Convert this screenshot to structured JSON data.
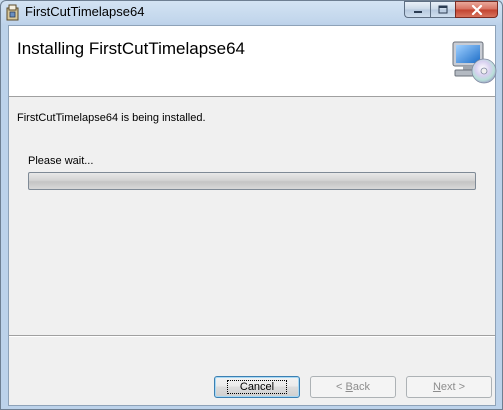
{
  "window": {
    "title": "FirstCutTimelapse64",
    "controls": {
      "minimize_icon": "minimize-icon",
      "maximize_icon": "maximize-icon",
      "close_icon": "close-icon"
    }
  },
  "header": {
    "title": "Installing FirstCutTimelapse64",
    "icon": "computer-cd-icon"
  },
  "body": {
    "status": "FirstCutTimelapse64 is being installed.",
    "wait_label": "Please wait...",
    "progress_fraction": 0.0
  },
  "footer": {
    "cancel": {
      "label": "Cancel",
      "enabled": true
    },
    "back": {
      "mnemonic": "B",
      "rest": "ack",
      "prefix": "< ",
      "enabled": false
    },
    "next": {
      "mnemonic": "N",
      "rest": "ext",
      "suffix": " >",
      "enabled": false
    }
  },
  "colors": {
    "header_bg": "#ffffff",
    "client_bg": "#f0f0f0",
    "disabled_text": "#8d8d8d",
    "close_button": "#c2422f"
  }
}
